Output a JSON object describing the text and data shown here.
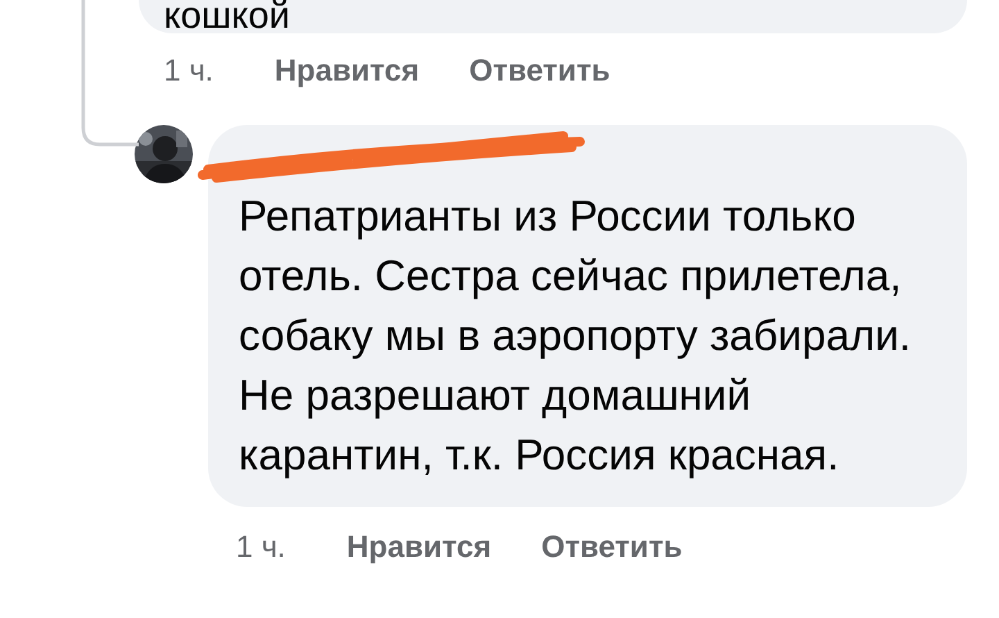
{
  "previous_comment": {
    "text": "кошкой",
    "actions": [
      {
        "label": "1 ч.",
        "kind": "time"
      },
      {
        "label": "Нравится",
        "kind": "link"
      },
      {
        "label": "Ответить",
        "kind": "link"
      }
    ]
  },
  "reply": {
    "redacted_name": true,
    "text": "Репатрианты из России только отель. Сестра сейчас прилетела, собаку мы в аэропорту забирали. Не разрешают домашний карантин, т.к. Россия красная.",
    "actions": [
      {
        "label": "1 ч.",
        "kind": "time"
      },
      {
        "label": "Нравится",
        "kind": "link"
      },
      {
        "label": "Ответить",
        "kind": "link"
      }
    ]
  }
}
